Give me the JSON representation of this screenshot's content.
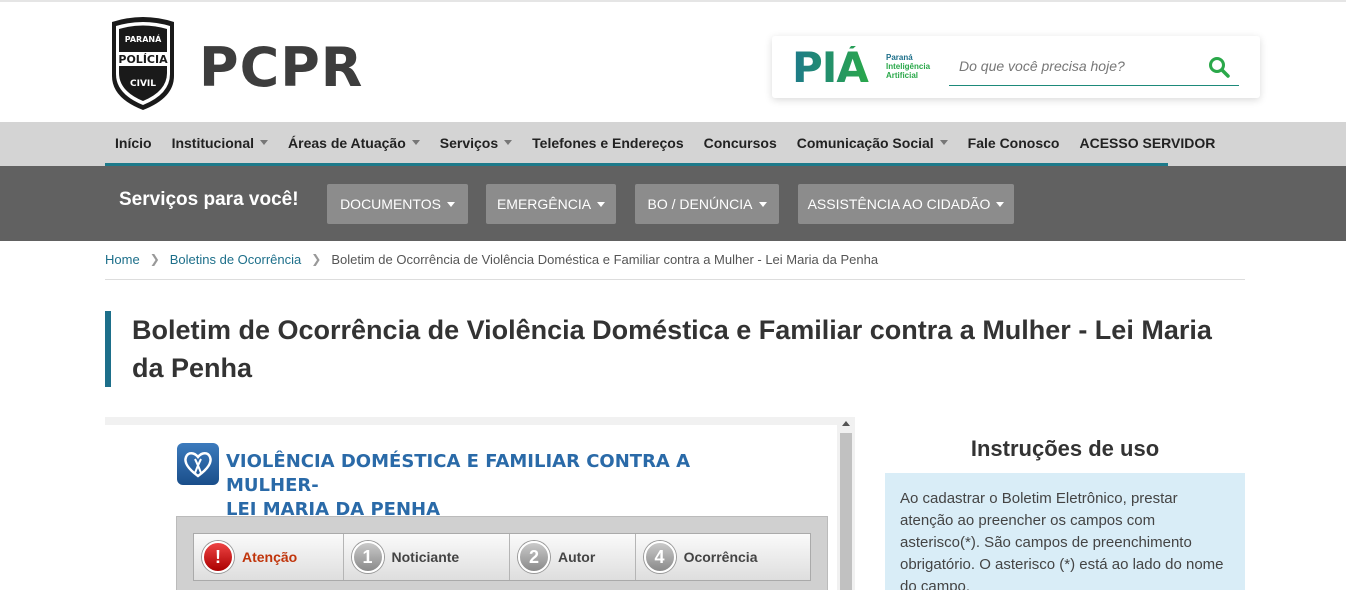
{
  "header": {
    "badge_text": [
      "PARANÁ",
      "POLÍCIA",
      "CIVIL"
    ],
    "brand": "PCPR",
    "pia": {
      "logo_text": "PIÁ",
      "sub_lines": [
        "Paraná",
        "Inteligência",
        "Artificial"
      ]
    },
    "search_placeholder": "Do que você precisa hoje?"
  },
  "nav": {
    "items": [
      {
        "label": "Início",
        "dropdown": false
      },
      {
        "label": "Institucional",
        "dropdown": true
      },
      {
        "label": "Áreas de Atuação",
        "dropdown": true
      },
      {
        "label": "Serviços",
        "dropdown": true
      },
      {
        "label": "Telefones e Endereços",
        "dropdown": false
      },
      {
        "label": "Concursos",
        "dropdown": false
      },
      {
        "label": "Comunicação Social",
        "dropdown": true
      },
      {
        "label": "Fale Conosco",
        "dropdown": false
      },
      {
        "label": "ACESSO SERVIDOR",
        "dropdown": false
      }
    ]
  },
  "services": {
    "title": "Serviços para você!",
    "buttons": [
      "DOCUMENTOS",
      "EMERGÊNCIA",
      "BO / DENÚNCIA",
      "ASSISTÊNCIA AO CIDADÃO"
    ]
  },
  "breadcrumb": {
    "home": "Home",
    "section": "Boletins de Ocorrência",
    "current": "Boletim de Ocorrência de Violência Doméstica e Familiar contra a Mulher - Lei Maria da Penha"
  },
  "page_title": "Boletim de Ocorrência de Violência Doméstica e Familiar contra a Mulher - Lei Maria da Penha",
  "form": {
    "heading_line1": "VIOLÊNCIA DOMÉSTICA E FAMILIAR CONTRA A MULHER-",
    "heading_line2": "LEI MARIA DA PENHA",
    "steps": [
      {
        "num": "!",
        "label": "Atenção",
        "active": true
      },
      {
        "num": "1",
        "label": "Noticiante",
        "active": false
      },
      {
        "num": "2",
        "label": "Autor",
        "active": false
      },
      {
        "num": "4",
        "label": "Ocorrência",
        "active": false
      }
    ]
  },
  "instructions": {
    "title": "Instruções de uso",
    "text": "Ao cadastrar o Boletim Eletrônico, prestar atenção ao preencher os campos com asterisco(*). São campos de preenchimento obrigatório. O asterisco (*) está ao lado do nome do campo."
  }
}
